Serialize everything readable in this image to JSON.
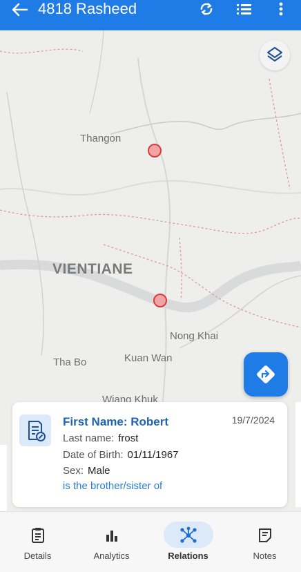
{
  "header": {
    "title": "4818 Rasheed",
    "icons": [
      "back-arrow-icon",
      "sync-icon",
      "list-icon",
      "more-vert-icon"
    ]
  },
  "map": {
    "place_labels": [
      "Thangon",
      "VIENTIANE",
      "Nong Khai",
      "Tha Bo",
      "Kuan Wan",
      "Wiang Khuk"
    ],
    "marker_color": "#d83b3b",
    "icons": [
      "layers-icon",
      "directions-icon"
    ]
  },
  "card": {
    "first_name": "First Name: Robert",
    "date": "19/7/2024",
    "last_name_label": "Last name:",
    "last_name_value": "frost",
    "dob_label": "Date of Birth:",
    "dob_value": "01/11/1967",
    "sex_label": "Sex:",
    "sex_value": "Male",
    "relation": "is the brother/sister of",
    "icon": "document-edit-icon"
  },
  "bottom_nav": {
    "items": [
      {
        "label": "Details",
        "icon": "clipboard-icon"
      },
      {
        "label": "Analytics",
        "icon": "bar-chart-icon"
      },
      {
        "label": "Relations",
        "icon": "network-icon"
      },
      {
        "label": "Notes",
        "icon": "notes-icon"
      }
    ],
    "active": "Relations"
  },
  "colors": {
    "primary": "#1f7be6",
    "link": "#2a7cd8",
    "heading": "#1e63b8"
  }
}
